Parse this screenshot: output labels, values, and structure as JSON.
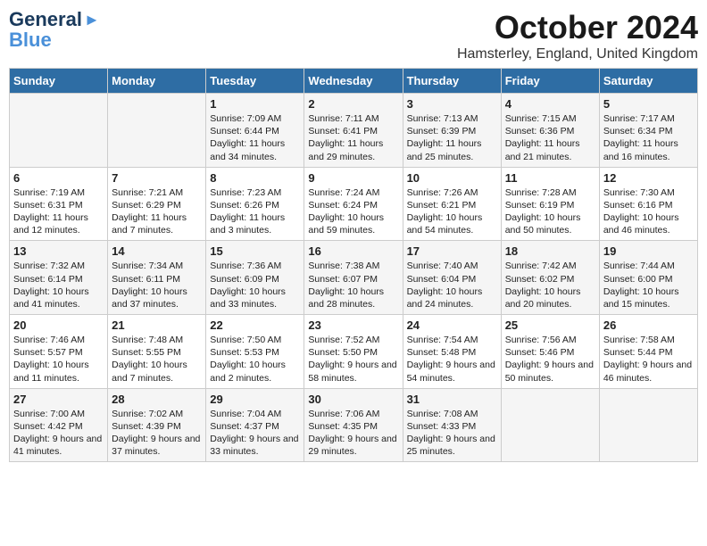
{
  "header": {
    "logo_line1": "General",
    "logo_line2": "Blue",
    "month": "October 2024",
    "location": "Hamsterley, England, United Kingdom"
  },
  "days_of_week": [
    "Sunday",
    "Monday",
    "Tuesday",
    "Wednesday",
    "Thursday",
    "Friday",
    "Saturday"
  ],
  "weeks": [
    [
      {
        "num": "",
        "sunrise": "",
        "sunset": "",
        "daylight": ""
      },
      {
        "num": "",
        "sunrise": "",
        "sunset": "",
        "daylight": ""
      },
      {
        "num": "1",
        "sunrise": "Sunrise: 7:09 AM",
        "sunset": "Sunset: 6:44 PM",
        "daylight": "Daylight: 11 hours and 34 minutes."
      },
      {
        "num": "2",
        "sunrise": "Sunrise: 7:11 AM",
        "sunset": "Sunset: 6:41 PM",
        "daylight": "Daylight: 11 hours and 29 minutes."
      },
      {
        "num": "3",
        "sunrise": "Sunrise: 7:13 AM",
        "sunset": "Sunset: 6:39 PM",
        "daylight": "Daylight: 11 hours and 25 minutes."
      },
      {
        "num": "4",
        "sunrise": "Sunrise: 7:15 AM",
        "sunset": "Sunset: 6:36 PM",
        "daylight": "Daylight: 11 hours and 21 minutes."
      },
      {
        "num": "5",
        "sunrise": "Sunrise: 7:17 AM",
        "sunset": "Sunset: 6:34 PM",
        "daylight": "Daylight: 11 hours and 16 minutes."
      }
    ],
    [
      {
        "num": "6",
        "sunrise": "Sunrise: 7:19 AM",
        "sunset": "Sunset: 6:31 PM",
        "daylight": "Daylight: 11 hours and 12 minutes."
      },
      {
        "num": "7",
        "sunrise": "Sunrise: 7:21 AM",
        "sunset": "Sunset: 6:29 PM",
        "daylight": "Daylight: 11 hours and 7 minutes."
      },
      {
        "num": "8",
        "sunrise": "Sunrise: 7:23 AM",
        "sunset": "Sunset: 6:26 PM",
        "daylight": "Daylight: 11 hours and 3 minutes."
      },
      {
        "num": "9",
        "sunrise": "Sunrise: 7:24 AM",
        "sunset": "Sunset: 6:24 PM",
        "daylight": "Daylight: 10 hours and 59 minutes."
      },
      {
        "num": "10",
        "sunrise": "Sunrise: 7:26 AM",
        "sunset": "Sunset: 6:21 PM",
        "daylight": "Daylight: 10 hours and 54 minutes."
      },
      {
        "num": "11",
        "sunrise": "Sunrise: 7:28 AM",
        "sunset": "Sunset: 6:19 PM",
        "daylight": "Daylight: 10 hours and 50 minutes."
      },
      {
        "num": "12",
        "sunrise": "Sunrise: 7:30 AM",
        "sunset": "Sunset: 6:16 PM",
        "daylight": "Daylight: 10 hours and 46 minutes."
      }
    ],
    [
      {
        "num": "13",
        "sunrise": "Sunrise: 7:32 AM",
        "sunset": "Sunset: 6:14 PM",
        "daylight": "Daylight: 10 hours and 41 minutes."
      },
      {
        "num": "14",
        "sunrise": "Sunrise: 7:34 AM",
        "sunset": "Sunset: 6:11 PM",
        "daylight": "Daylight: 10 hours and 37 minutes."
      },
      {
        "num": "15",
        "sunrise": "Sunrise: 7:36 AM",
        "sunset": "Sunset: 6:09 PM",
        "daylight": "Daylight: 10 hours and 33 minutes."
      },
      {
        "num": "16",
        "sunrise": "Sunrise: 7:38 AM",
        "sunset": "Sunset: 6:07 PM",
        "daylight": "Daylight: 10 hours and 28 minutes."
      },
      {
        "num": "17",
        "sunrise": "Sunrise: 7:40 AM",
        "sunset": "Sunset: 6:04 PM",
        "daylight": "Daylight: 10 hours and 24 minutes."
      },
      {
        "num": "18",
        "sunrise": "Sunrise: 7:42 AM",
        "sunset": "Sunset: 6:02 PM",
        "daylight": "Daylight: 10 hours and 20 minutes."
      },
      {
        "num": "19",
        "sunrise": "Sunrise: 7:44 AM",
        "sunset": "Sunset: 6:00 PM",
        "daylight": "Daylight: 10 hours and 15 minutes."
      }
    ],
    [
      {
        "num": "20",
        "sunrise": "Sunrise: 7:46 AM",
        "sunset": "Sunset: 5:57 PM",
        "daylight": "Daylight: 10 hours and 11 minutes."
      },
      {
        "num": "21",
        "sunrise": "Sunrise: 7:48 AM",
        "sunset": "Sunset: 5:55 PM",
        "daylight": "Daylight: 10 hours and 7 minutes."
      },
      {
        "num": "22",
        "sunrise": "Sunrise: 7:50 AM",
        "sunset": "Sunset: 5:53 PM",
        "daylight": "Daylight: 10 hours and 2 minutes."
      },
      {
        "num": "23",
        "sunrise": "Sunrise: 7:52 AM",
        "sunset": "Sunset: 5:50 PM",
        "daylight": "Daylight: 9 hours and 58 minutes."
      },
      {
        "num": "24",
        "sunrise": "Sunrise: 7:54 AM",
        "sunset": "Sunset: 5:48 PM",
        "daylight": "Daylight: 9 hours and 54 minutes."
      },
      {
        "num": "25",
        "sunrise": "Sunrise: 7:56 AM",
        "sunset": "Sunset: 5:46 PM",
        "daylight": "Daylight: 9 hours and 50 minutes."
      },
      {
        "num": "26",
        "sunrise": "Sunrise: 7:58 AM",
        "sunset": "Sunset: 5:44 PM",
        "daylight": "Daylight: 9 hours and 46 minutes."
      }
    ],
    [
      {
        "num": "27",
        "sunrise": "Sunrise: 7:00 AM",
        "sunset": "Sunset: 4:42 PM",
        "daylight": "Daylight: 9 hours and 41 minutes."
      },
      {
        "num": "28",
        "sunrise": "Sunrise: 7:02 AM",
        "sunset": "Sunset: 4:39 PM",
        "daylight": "Daylight: 9 hours and 37 minutes."
      },
      {
        "num": "29",
        "sunrise": "Sunrise: 7:04 AM",
        "sunset": "Sunset: 4:37 PM",
        "daylight": "Daylight: 9 hours and 33 minutes."
      },
      {
        "num": "30",
        "sunrise": "Sunrise: 7:06 AM",
        "sunset": "Sunset: 4:35 PM",
        "daylight": "Daylight: 9 hours and 29 minutes."
      },
      {
        "num": "31",
        "sunrise": "Sunrise: 7:08 AM",
        "sunset": "Sunset: 4:33 PM",
        "daylight": "Daylight: 9 hours and 25 minutes."
      },
      {
        "num": "",
        "sunrise": "",
        "sunset": "",
        "daylight": ""
      },
      {
        "num": "",
        "sunrise": "",
        "sunset": "",
        "daylight": ""
      }
    ]
  ]
}
